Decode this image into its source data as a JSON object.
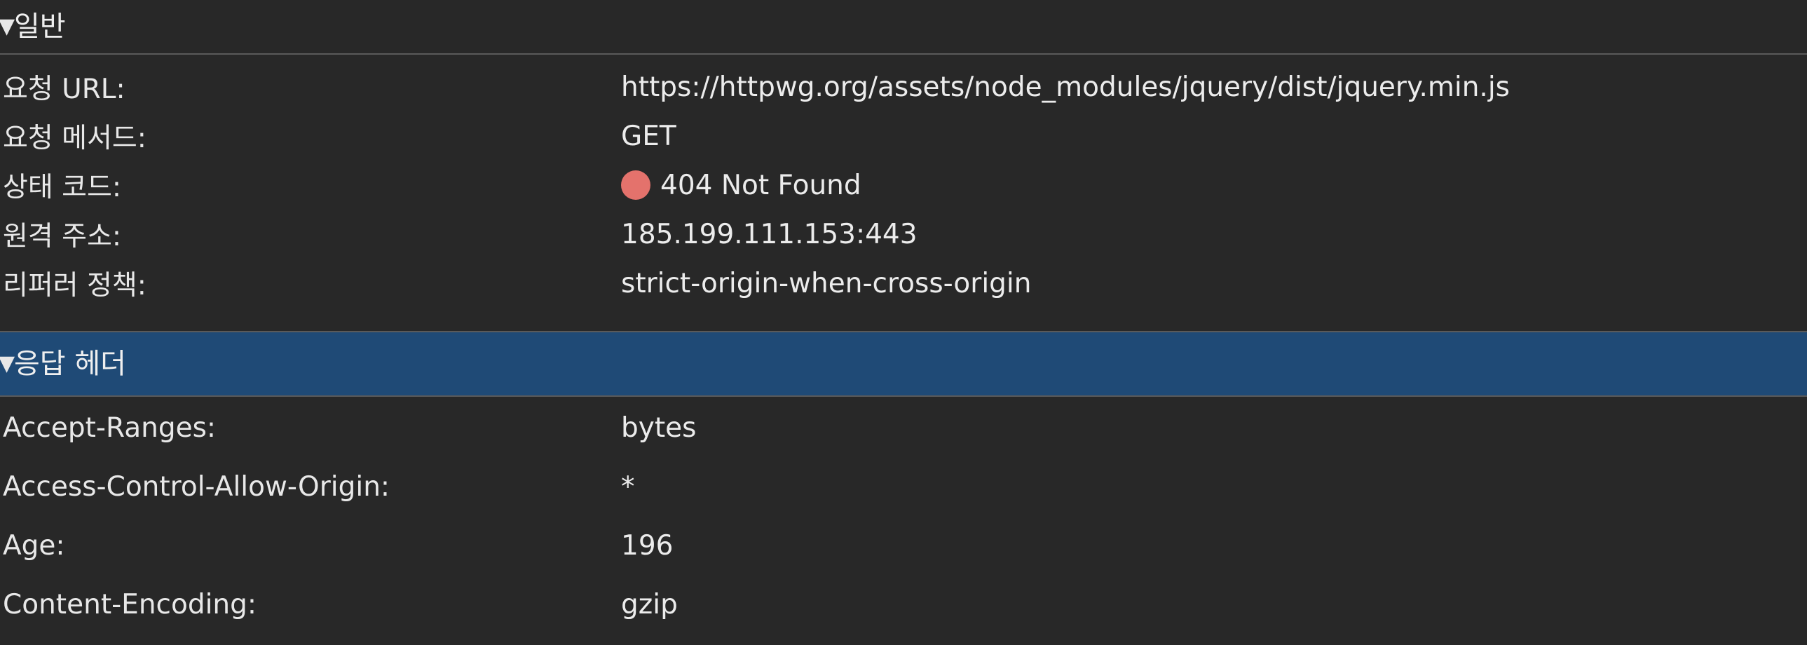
{
  "general": {
    "arrow": "▼",
    "title": "일반",
    "rows": [
      {
        "key": "요청 URL:",
        "value": "https://httpwg.org/assets/node_modules/jquery/dist/jquery.min.js"
      },
      {
        "key": "요청 메서드:",
        "value": "GET"
      },
      {
        "key": "상태 코드:",
        "value": "404 Not Found"
      },
      {
        "key": "원격 주소:",
        "value": "185.199.111.153:443"
      },
      {
        "key": "리퍼러 정책:",
        "value": "strict-origin-when-cross-origin"
      }
    ],
    "status_color": "#e4726c"
  },
  "response_headers": {
    "arrow": "▼",
    "title": "응답 헤더",
    "highlight_color": "#1f4a76",
    "rows": [
      {
        "key": "Accept-Ranges:",
        "value": "bytes"
      },
      {
        "key": "Access-Control-Allow-Origin:",
        "value": "*"
      },
      {
        "key": "Age:",
        "value": "196"
      },
      {
        "key": "Content-Encoding:",
        "value": "gzip"
      }
    ]
  }
}
